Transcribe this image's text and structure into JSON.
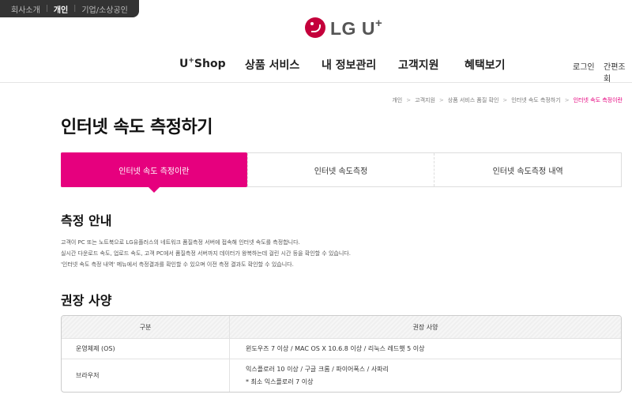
{
  "segments": [
    "회사소개",
    "개인",
    "기업/소상공인"
  ],
  "logo": {
    "text": "LG U",
    "plus": "+"
  },
  "gnb": {
    "menu_shop": "U",
    "menu_shop_sup": "+",
    "menu_shop_rest": "Shop",
    "menus": [
      "상품 서비스",
      "내 정보관리",
      "고객지원",
      "혜택보기"
    ],
    "login": "로그인",
    "easy_lookup": "간편조회"
  },
  "breadcrumb": [
    "개인",
    "고객지원",
    "상품 서비스 품질 확인",
    "인터넷 속도 측정하기",
    "인터넷 속도 측정이란"
  ],
  "page_title": "인터넷 속도 측정하기",
  "tabs": [
    "인터넷 속도 측정이란",
    "인터넷 속도측정",
    "인터넷 속도측정 내역"
  ],
  "guide": {
    "title": "측정 안내",
    "lines": [
      "고객이 PC 또는 노트북으로 LG유플러스의 네트워크 품질측정 서버에 접속해 인터넷 속도를 측정합니다.",
      "실시간 다운로드 속도, 업로드 속도, 고객 PC에서 품질측정 서버까지 데이터가 왕복하는데 걸린 시간 등을 확인할 수 있습니다.",
      "'인터넷 속도 측정 내역' 메뉴에서 측정결과를 확인할 수 있으며 이전 측정 결과도 확인할 수 있습니다."
    ]
  },
  "spec": {
    "title": "권장 사양",
    "headers": [
      "구분",
      "권장 사양"
    ],
    "rows": [
      {
        "label": "운영체제 (OS)",
        "lines": [
          "윈도우즈 7 이상 / MAC OS X 10.6.8 이상 / 리눅스 레드햇 5 이상"
        ]
      },
      {
        "label": "브라우저",
        "lines": [
          "익스플로러 10 이상 / 구글 크롬 / 파이어폭스 / 사파리",
          "* 최소 익스플로러 7 이상"
        ]
      }
    ]
  },
  "colors": {
    "brand_magenta": "#e6007e",
    "logo_red": "#c4003b",
    "segbar_bg": "#333333"
  }
}
